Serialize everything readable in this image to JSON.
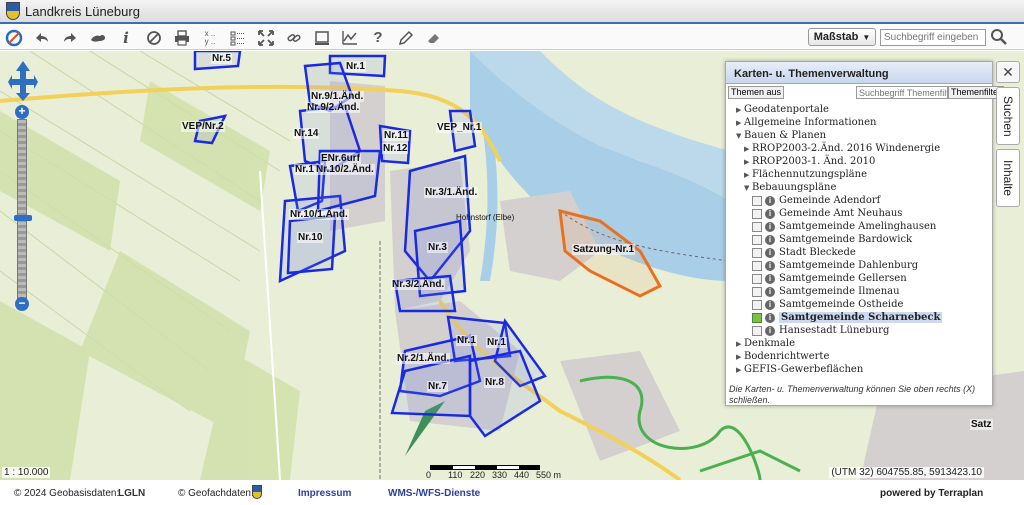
{
  "app": {
    "title": "Landkreis Lüneburg"
  },
  "toolbar": {
    "scale_label": "Maßstab",
    "search_placeholder": "Suchbegriff eingeben",
    "xy_label": "x\ny"
  },
  "map": {
    "labels": [
      "Nr.5",
      "Nr.1",
      "Nr.9/1.Änd.",
      "Nr.9/2.Änd.",
      "VEP/Nr.2",
      "Nr.14",
      "Nr.11",
      "Nr.12",
      "VEP_Nr.1",
      "ENr.6urf",
      "Nr.1",
      "Nr.10/2.Änd.",
      "Nr.3/1.Änd.",
      "Nr.10/1.Änd.",
      "Nr.10",
      "Nr.3",
      "Satzung-Nr.1",
      "Nr.3/2.Änd.",
      "Nr.1",
      "Nr.1",
      "Nr.2/1.Änd.",
      "Nr.7",
      "Nr.8",
      "Hohnstorf (Elbe)",
      "Satz"
    ],
    "scale_text": "1 : 10.000",
    "coords": "(UTM 32) 604755.85, 5913423.10",
    "scalebar_labels": [
      "0",
      "110",
      "220",
      "330",
      "440",
      "550 m"
    ]
  },
  "panel": {
    "title": "Karten- u. Themenverwaltung",
    "btn_themes_off": "Themen aus",
    "search_placeholder": "Suchbegriff Themenfilter",
    "btn_filter": "Themenfilter",
    "footer": "Die Karten- u. Themenverwaltung können Sie oben rechts (X) schließen.",
    "tree": [
      {
        "label": "Geodatenportale",
        "type": "folder",
        "level": 0
      },
      {
        "label": "Allgemeine Informationen",
        "type": "folder",
        "level": 0
      },
      {
        "label": "Bauen & Planen",
        "type": "open",
        "level": 0
      },
      {
        "label": "RROP2003-2.Änd. 2016 Windenergie",
        "type": "folder",
        "level": 1
      },
      {
        "label": "RROP2003-1. Änd. 2010",
        "type": "folder",
        "level": 1
      },
      {
        "label": "Flächennutzungspläne",
        "type": "folder",
        "level": 1
      },
      {
        "label": "Bebauungspläne",
        "type": "open",
        "level": 1
      },
      {
        "label": "Gemeinde Adendorf",
        "type": "layer",
        "level": 2,
        "checked": false
      },
      {
        "label": "Gemeinde Amt Neuhaus",
        "type": "layer",
        "level": 2,
        "checked": false
      },
      {
        "label": "Samtgemeinde Amelinghausen",
        "type": "layer",
        "level": 2,
        "checked": false
      },
      {
        "label": "Samtgemeinde Bardowick",
        "type": "layer",
        "level": 2,
        "checked": false
      },
      {
        "label": "Stadt Bleckede",
        "type": "layer",
        "level": 2,
        "checked": false
      },
      {
        "label": "Samtgemeinde Dahlenburg",
        "type": "layer",
        "level": 2,
        "checked": false
      },
      {
        "label": "Samtgemeinde Gellersen",
        "type": "layer",
        "level": 2,
        "checked": false
      },
      {
        "label": "Samtgemeinde Ilmenau",
        "type": "layer",
        "level": 2,
        "checked": false
      },
      {
        "label": "Samtgemeinde Ostheide",
        "type": "layer",
        "level": 2,
        "checked": false
      },
      {
        "label": "Samtgemeinde Scharnebeck",
        "type": "layer",
        "level": 2,
        "checked": true,
        "selected": true
      },
      {
        "label": "Hansestadt Lüneburg",
        "type": "layer",
        "level": 2,
        "checked": false
      },
      {
        "label": "Denkmale",
        "type": "folder",
        "level": 0
      },
      {
        "label": "Bodenrichtwerte",
        "type": "folder",
        "level": 0
      },
      {
        "label": "GEFIS-Gewerbeflächen",
        "type": "folder",
        "level": 0
      }
    ]
  },
  "side_tabs": {
    "close": "✕",
    "search": "Suchen",
    "contents": "Inhalte"
  },
  "footer": {
    "geobasis": "© 2024 Geobasisdaten:",
    "lgln": "LGLN",
    "geofach": "© Geofachdaten:",
    "impressum": "Impressum",
    "wms": "WMS-/WFS-Dienste",
    "powered": "powered by Terraplan"
  }
}
